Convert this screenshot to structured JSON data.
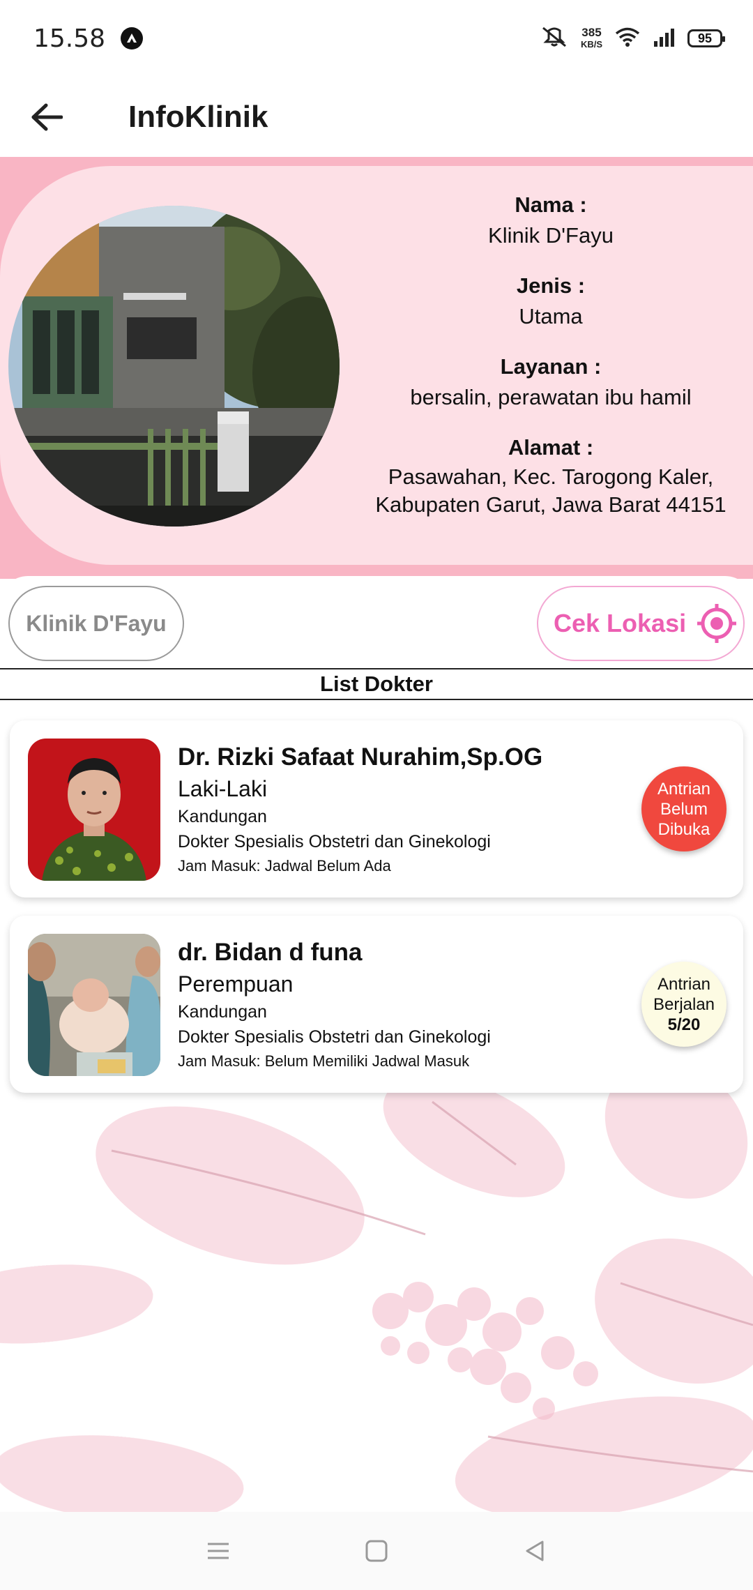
{
  "status_bar": {
    "time": "15.58",
    "speed_value": "385",
    "speed_unit": "KB/S",
    "battery": "95"
  },
  "app_bar": {
    "title": "InfoKlinik",
    "back_icon": "arrow-left-icon"
  },
  "clinic": {
    "fields": [
      {
        "label": "Nama :",
        "value": "Klinik D'Fayu"
      },
      {
        "label": "Jenis :",
        "value": "Utama"
      },
      {
        "label": "Layanan :",
        "value": "bersalin, perawatan ibu hamil"
      },
      {
        "label": "Alamat :",
        "value": "Pasawahan, Kec. Tarogong Kaler,\nKabupaten Garut, Jawa Barat 44151"
      }
    ],
    "name_pill": "Klinik D'Fayu",
    "location_button": "Cek Lokasi"
  },
  "doctors_section": {
    "title": "List Dokter",
    "doctors": [
      {
        "name": "Dr. Rizki Safaat Nurahim,Sp.OG",
        "gender": "Laki-Laki",
        "department": "Kandungan",
        "specialty": "Dokter Spesialis Obstetri dan Ginekologi",
        "hours": "Jam Masuk: Jadwal Belum Ada",
        "queue_line1": "Antrian",
        "queue_line2": "Belum",
        "queue_line3": "Dibuka"
      },
      {
        "name": "dr. Bidan d funa",
        "gender": "Perempuan",
        "department": "Kandungan",
        "specialty": "Dokter Spesialis Obstetri dan Ginekologi",
        "hours": "Jam Masuk: Belum Memiliki Jadwal Masuk",
        "queue_line1": "Antrian",
        "queue_line2": "Berjalan",
        "queue_count": "5/20"
      }
    ]
  },
  "colors": {
    "pink_band": "#f9b5c4",
    "pink_card": "#fde0e6",
    "accent_pink": "#ec5fb2",
    "badge_closed": "#f0483e",
    "badge_open": "#fdfbe3"
  },
  "nav_bar": {
    "icons": [
      "menu-icon",
      "home-square-icon",
      "back-triangle-icon"
    ]
  }
}
